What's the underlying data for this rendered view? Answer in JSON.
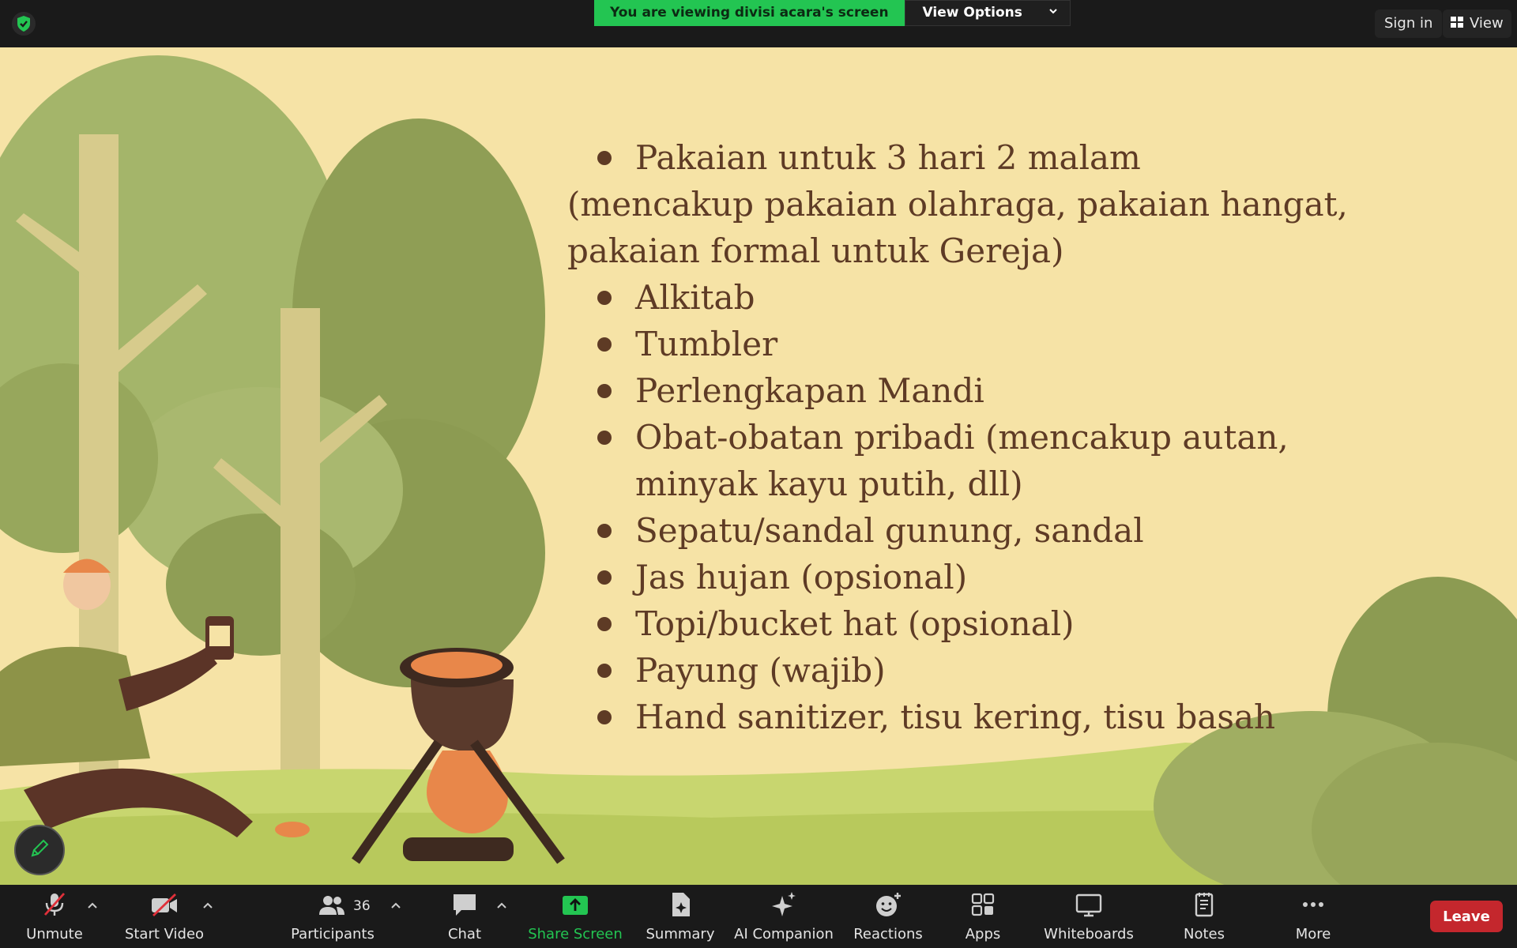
{
  "top_bar": {
    "viewing_label": "You are viewing divisi acara's screen",
    "view_options_label": "View Options",
    "sign_in_label": "Sign in",
    "view_label": "View"
  },
  "slide": {
    "items": [
      {
        "text": "Pakaian untuk 3 hari 2 malam",
        "bullet": true
      },
      {
        "text": "(mencakup pakaian olahraga, pakaian hangat,",
        "bullet": false,
        "indent": "none"
      },
      {
        "text": "pakaian formal untuk Gereja)",
        "bullet": false,
        "indent": "none"
      },
      {
        "text": "Alkitab",
        "bullet": true
      },
      {
        "text": "Tumbler",
        "bullet": true
      },
      {
        "text": "Perlengkapan Mandi",
        "bullet": true
      },
      {
        "text": "Obat-obatan pribadi (mencakup autan,",
        "bullet": true
      },
      {
        "text": "minyak kayu putih, dll)",
        "bullet": false,
        "indent": "hang"
      },
      {
        "text": "Sepatu/sandal gunung, sandal",
        "bullet": true
      },
      {
        "text": "Jas hujan (opsional)",
        "bullet": true
      },
      {
        "text": "Topi/bucket hat (opsional)",
        "bullet": true
      },
      {
        "text": "Payung (wajib)",
        "bullet": true
      },
      {
        "text": "Hand sanitizer, tisu kering, tisu basah",
        "bullet": true
      }
    ]
  },
  "toolbar": {
    "unmute_label": "Unmute",
    "start_video_label": "Start Video",
    "participants_label": "Participants",
    "participants_count": "36",
    "chat_label": "Chat",
    "share_screen_label": "Share Screen",
    "summary_label": "Summary",
    "ai_companion_label": "AI Companion",
    "reactions_label": "Reactions",
    "apps_label": "Apps",
    "whiteboards_label": "Whiteboards",
    "notes_label": "Notes",
    "more_label": "More",
    "leave_label": "Leave"
  },
  "colors": {
    "banner_green": "#23c552",
    "leave_red": "#c4272d",
    "slide_bg": "#f6e3a6",
    "slide_text": "#5e3b25",
    "share_icon_green": "#23c552"
  },
  "icons": [
    "shield-check-icon",
    "chevron-down-icon",
    "grid-view-icon",
    "pencil-icon",
    "microphone-muted-icon",
    "video-off-icon",
    "participants-icon",
    "chat-icon",
    "share-screen-icon",
    "summary-icon",
    "ai-sparkle-icon",
    "reactions-icon",
    "apps-icon",
    "whiteboard-icon",
    "notes-icon",
    "more-dots-icon"
  ]
}
